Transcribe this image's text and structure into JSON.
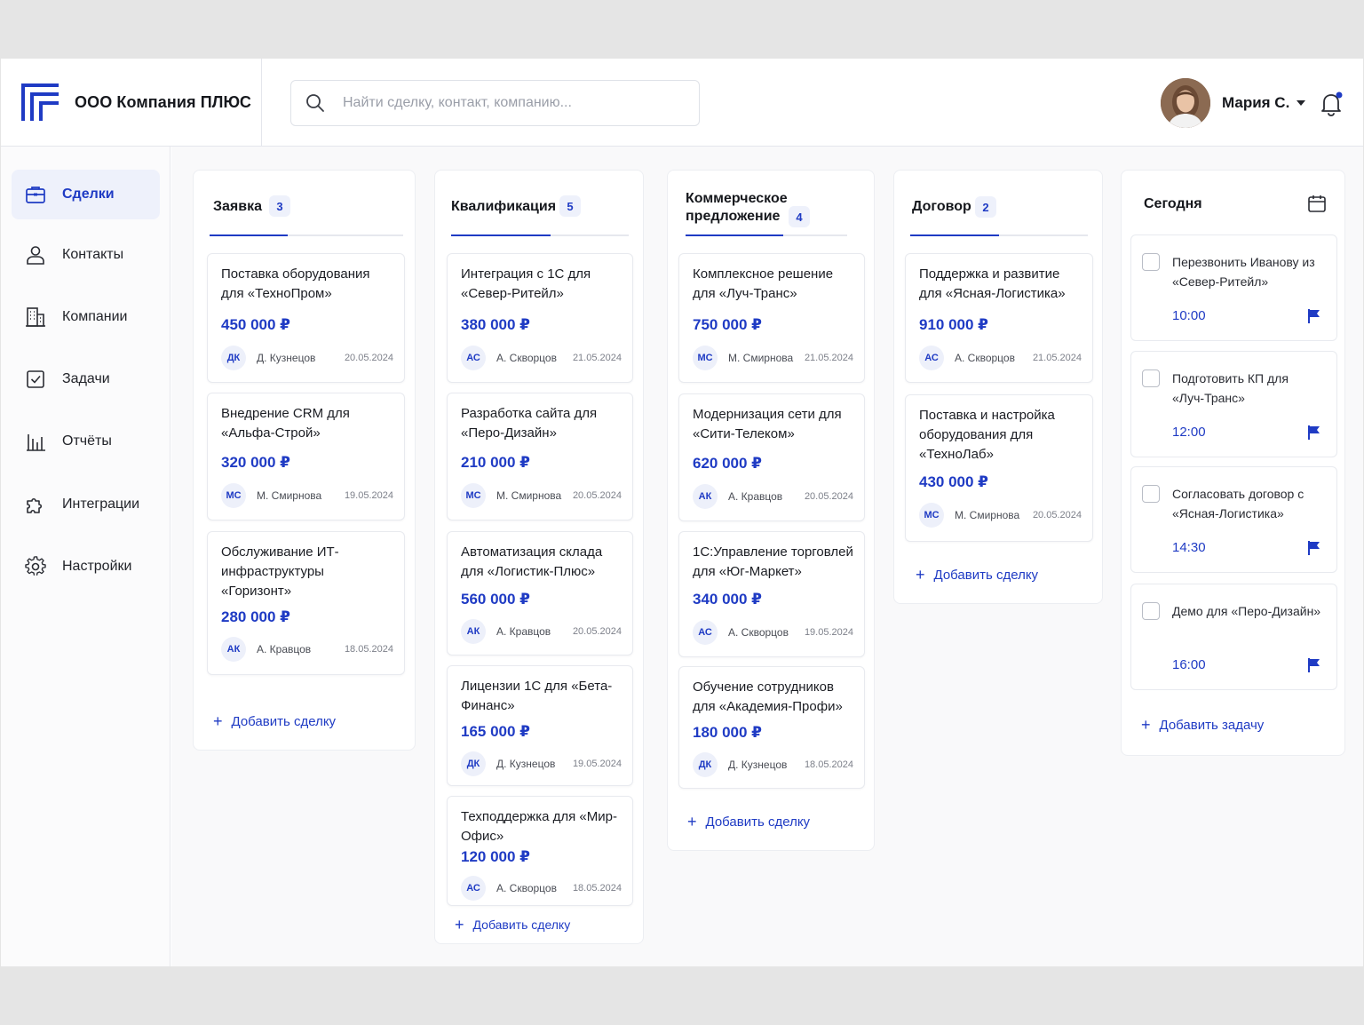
{
  "app": {
    "company_name": "ООО Компания ПЛЮС"
  },
  "search": {
    "placeholder": "Найти сделку, контакт, компанию..."
  },
  "user": {
    "name": "Мария С."
  },
  "colors": {
    "accent": "#1f3bc4",
    "badge_bg": "#eef1fb",
    "border": "#e8eaef"
  },
  "sidebar": {
    "items": [
      {
        "label": "Сделки",
        "icon": "briefcase-icon",
        "active": true
      },
      {
        "label": "Контакты",
        "icon": "person-icon",
        "active": false
      },
      {
        "label": "Компании",
        "icon": "building-icon",
        "active": false
      },
      {
        "label": "Задачи",
        "icon": "checkbox-icon",
        "active": false
      },
      {
        "label": "Отчёты",
        "icon": "bar-chart-icon",
        "active": false
      },
      {
        "label": "Интеграции",
        "icon": "puzzle-icon",
        "active": false
      },
      {
        "label": "Настройки",
        "icon": "gear-icon",
        "active": false
      }
    ]
  },
  "board": {
    "columns": [
      {
        "title": "Заявка",
        "count": "3",
        "add_label": "Добавить сделку",
        "cards": [
          {
            "title": "Поставка оборудования для «ТехноПром»",
            "amount": "450 000 ₽",
            "initials": "ДК",
            "person": "Д. Кузнецов",
            "date": "20.05.2024"
          },
          {
            "title": "Внедрение CRM для «Альфа-Строй»",
            "amount": "320 000 ₽",
            "initials": "МС",
            "person": "М. Смирнова",
            "date": "19.05.2024"
          },
          {
            "title": "Обслуживание ИТ-инфраструктуры «Горизонт»",
            "amount": "280 000 ₽",
            "initials": "АК",
            "person": "А. Кравцов",
            "date": "18.05.2024"
          }
        ]
      },
      {
        "title": "Квалификация",
        "count": "5",
        "add_label": "Добавить сделку",
        "cards": [
          {
            "title": "Интеграция с 1С для «Север-Ритейл»",
            "amount": "380 000 ₽",
            "initials": "АС",
            "person": "А. Скворцов",
            "date": "21.05.2024"
          },
          {
            "title": "Разработка сайта для «Перо-Дизайн»",
            "amount": "210 000 ₽",
            "initials": "МС",
            "person": "М. Смирнова",
            "date": "20.05.2024"
          },
          {
            "title": "Автоматизация склада для «Логистик-Плюс»",
            "amount": "560 000 ₽",
            "initials": "АК",
            "person": "А. Кравцов",
            "date": "20.05.2024"
          },
          {
            "title": "Лицензии 1С для «Бета-Финанс»",
            "amount": "165 000 ₽",
            "initials": "ДК",
            "person": "Д. Кузнецов",
            "date": "19.05.2024"
          },
          {
            "title": "Техподдержка для «Мир-Офис»",
            "amount": "120 000 ₽",
            "initials": "АС",
            "person": "А. Скворцов",
            "date": "18.05.2024"
          }
        ]
      },
      {
        "title": "Коммерческое предложение",
        "count": "4",
        "add_label": "Добавить сделку",
        "cards": [
          {
            "title": "Комплексное решение для «Луч-Транс»",
            "amount": "750 000 ₽",
            "initials": "МС",
            "person": "М. Смирнова",
            "date": "21.05.2024"
          },
          {
            "title": "Модернизация сети для «Сити-Телеком»",
            "amount": "620 000 ₽",
            "initials": "АК",
            "person": "А. Кравцов",
            "date": "20.05.2024"
          },
          {
            "title": "1С:Управление торговлей для «Юг-Маркет»",
            "amount": "340 000 ₽",
            "initials": "АС",
            "person": "А. Скворцов",
            "date": "19.05.2024"
          },
          {
            "title": "Обучение сотрудников для «Академия-Профи»",
            "amount": "180 000 ₽",
            "initials": "ДК",
            "person": "Д. Кузнецов",
            "date": "18.05.2024"
          }
        ]
      },
      {
        "title": "Договор",
        "count": "2",
        "add_label": "Добавить сделку",
        "cards": [
          {
            "title": "Поддержка и развитие для «Ясная-Логистика»",
            "amount": "910 000 ₽",
            "initials": "АС",
            "person": "А. Скворцов",
            "date": "21.05.2024"
          },
          {
            "title": "Поставка и настройка оборудования для «ТехноЛаб»",
            "amount": "430 000 ₽",
            "initials": "МС",
            "person": "М. Смирнова",
            "date": "20.05.2024"
          }
        ]
      }
    ]
  },
  "today": {
    "title": "Сегодня",
    "add_label": "Добавить задачу",
    "tasks": [
      {
        "title": "Перезвонить Иванову из «Север-Ритейл»",
        "time": "10:00",
        "checked": false
      },
      {
        "title": "Подготовить КП для «Луч-Транс»",
        "time": "12:00",
        "checked": false
      },
      {
        "title": "Согласовать договор с «Ясная-Логистика»",
        "time": "14:30",
        "checked": false
      },
      {
        "title": "Демо для «Перо-Дизайн»",
        "time": "16:00",
        "checked": false
      }
    ]
  }
}
